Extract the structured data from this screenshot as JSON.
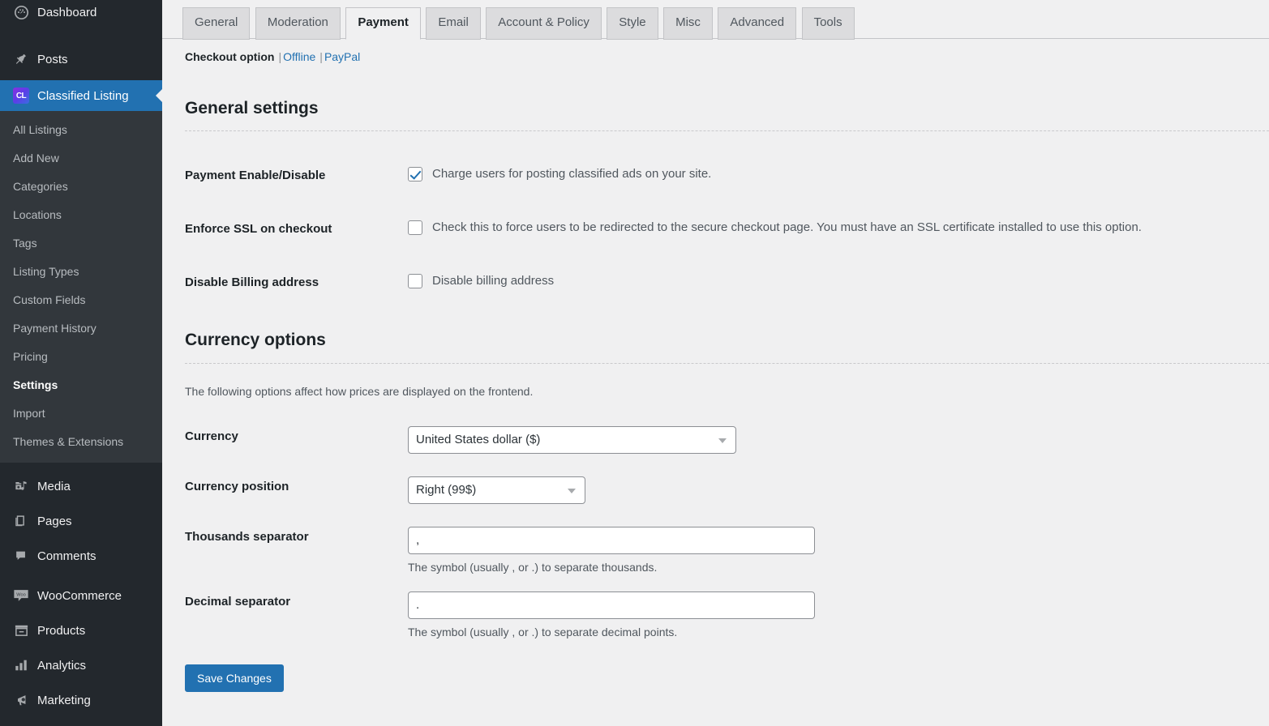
{
  "sidebar": {
    "top_items": [
      {
        "label": "Dashboard",
        "icon": "dashboard-icon",
        "glyph": "◷",
        "current": false,
        "sep_after": true
      },
      {
        "label": "Posts",
        "icon": "pin-icon",
        "glyph": "📌",
        "current": false,
        "sep_after": false
      },
      {
        "label": "Classified Listing",
        "icon": "classified-listing-badge-icon",
        "glyph": "CL",
        "current": true,
        "sep_after": false
      }
    ],
    "submenu_items": [
      {
        "label": "All Listings",
        "current": false
      },
      {
        "label": "Add New",
        "current": false
      },
      {
        "label": "Categories",
        "current": false
      },
      {
        "label": "Locations",
        "current": false
      },
      {
        "label": "Tags",
        "current": false
      },
      {
        "label": "Listing Types",
        "current": false
      },
      {
        "label": "Custom Fields",
        "current": false
      },
      {
        "label": "Payment History",
        "current": false
      },
      {
        "label": "Pricing",
        "current": false
      },
      {
        "label": "Settings",
        "current": true
      },
      {
        "label": "Import",
        "current": false
      },
      {
        "label": "Themes & Extensions",
        "current": false
      }
    ],
    "bottom_items": [
      {
        "label": "Media",
        "icon": "media-icon",
        "glyph": "🖼",
        "sep_before": true
      },
      {
        "label": "Pages",
        "icon": "pages-icon",
        "glyph": "📄",
        "sep_before": false
      },
      {
        "label": "Comments",
        "icon": "comments-icon",
        "glyph": "💬",
        "sep_before": false
      },
      {
        "label": "WooCommerce",
        "icon": "woocommerce-icon",
        "glyph": "Woo",
        "sep_before": true
      },
      {
        "label": "Products",
        "icon": "products-icon",
        "glyph": "▤",
        "sep_before": false
      },
      {
        "label": "Analytics",
        "icon": "analytics-icon",
        "glyph": "▮▮",
        "sep_before": false
      },
      {
        "label": "Marketing",
        "icon": "marketing-icon",
        "glyph": "📣",
        "sep_before": false
      }
    ],
    "highlight_color": "#2271b1"
  },
  "tabs": [
    {
      "label": "General",
      "active": false
    },
    {
      "label": "Moderation",
      "active": false
    },
    {
      "label": "Payment",
      "active": true
    },
    {
      "label": "Email",
      "active": false
    },
    {
      "label": "Account & Policy",
      "active": false
    },
    {
      "label": "Style",
      "active": false
    },
    {
      "label": "Misc",
      "active": false
    },
    {
      "label": "Advanced",
      "active": false
    },
    {
      "label": "Tools",
      "active": false
    }
  ],
  "checkout_option": {
    "title": "Checkout option",
    "separator": "|",
    "links": [
      {
        "label": "Offline"
      },
      {
        "label": "PayPal"
      }
    ]
  },
  "general_settings": {
    "heading": "General settings",
    "rows": [
      {
        "label": "Payment Enable/Disable",
        "checkbox_label": "Charge users for posting classified ads on your site.",
        "checked": true
      },
      {
        "label": "Enforce SSL on checkout",
        "checkbox_label": "Check this to force users to be redirected to the secure checkout page. You must have an SSL certificate installed to use this option.",
        "checked": false
      },
      {
        "label": "Disable Billing address",
        "checkbox_label": "Disable billing address",
        "checked": false
      }
    ]
  },
  "currency_options": {
    "heading": "Currency options",
    "description": "The following options affect how prices are displayed on the frontend.",
    "currency": {
      "label": "Currency",
      "value": "United States dollar ($)"
    },
    "currency_position": {
      "label": "Currency position",
      "value": "Right (99$)"
    },
    "thousands_separator": {
      "label": "Thousands separator",
      "value": ",",
      "help": "The symbol (usually , or .) to separate thousands."
    },
    "decimal_separator": {
      "label": "Decimal separator",
      "value": ".",
      "help": "The symbol (usually , or .) to separate decimal points."
    }
  },
  "actions": {
    "save_label": "Save Changes",
    "primary_color": "#2271b1"
  }
}
